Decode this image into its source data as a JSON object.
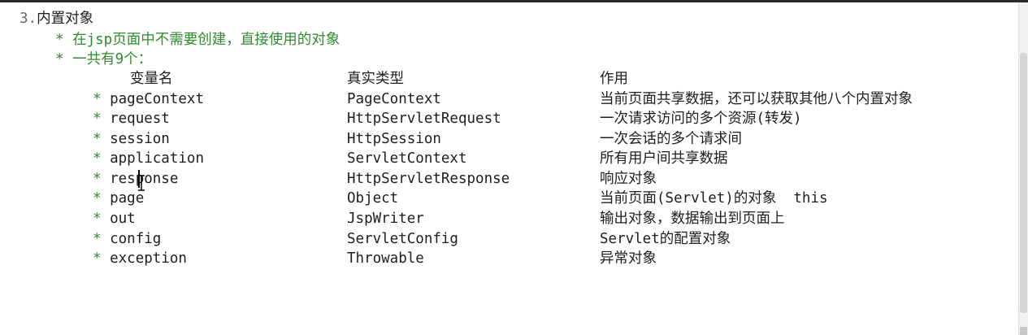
{
  "heading": {
    "number": "3.",
    "title": "内置对象"
  },
  "bullets": [
    {
      "star": "*",
      "text": "在jsp页面中不需要创建，直接使用的对象"
    },
    {
      "star": "*",
      "text": "一共有9个："
    }
  ],
  "table": {
    "headers": [
      "变量名",
      "真实类型",
      "作用"
    ],
    "rows": [
      {
        "star": "*",
        "name": "pageContext",
        "type": "PageContext",
        "desc": "当前页面共享数据，还可以获取其他八个内置对象"
      },
      {
        "star": "*",
        "name": "request",
        "type": "HttpServletRequest",
        "desc": "一次请求访问的多个资源(转发)"
      },
      {
        "star": "*",
        "name": "session",
        "type": "HttpSession",
        "desc": "一次会话的多个请求间"
      },
      {
        "star": "*",
        "name": "application",
        "type": "ServletContext",
        "desc": "所有用户间共享数据"
      },
      {
        "star": "*",
        "name": "response",
        "type": "HttpServletResponse",
        "desc": "响应对象"
      },
      {
        "star": "*",
        "name": "page",
        "type": "Object",
        "desc": "当前页面(Servlet)的对象  this"
      },
      {
        "star": "*",
        "name": "out",
        "type": "JspWriter",
        "desc": "输出对象，数据输出到页面上"
      },
      {
        "star": "*",
        "name": "config",
        "type": "ServletConfig",
        "desc": "Servlet的配置对象"
      },
      {
        "star": "*",
        "name": "exception",
        "type": "Throwable",
        "desc": "异常对象"
      }
    ]
  },
  "colors": {
    "text": "#1e1e1e",
    "bullet_green": "#2e8b2e",
    "number_gray": "#6a6a6a",
    "background": "#ffffff"
  }
}
